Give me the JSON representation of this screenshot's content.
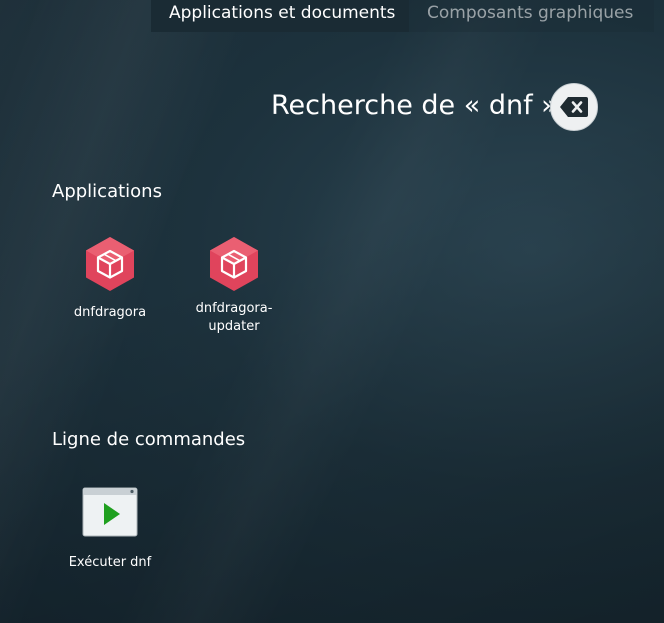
{
  "tabs": [
    {
      "label": "Applications et documents",
      "active": true
    },
    {
      "label": "Composants graphiques",
      "active": false
    }
  ],
  "search": {
    "title": "Recherche de « dnf »"
  },
  "sections": {
    "applications": {
      "title": "Applications",
      "items": [
        {
          "label": "dnfdragora",
          "icon": "package-icon"
        },
        {
          "label_line1": "dnfdragora-",
          "label_line2": "updater",
          "icon": "package-icon"
        }
      ]
    },
    "commands": {
      "title": "Ligne de commandes",
      "items": [
        {
          "label": "Exécuter dnf",
          "icon": "run-terminal-icon"
        }
      ]
    }
  },
  "colors": {
    "package_icon": "#e0445c",
    "run_icon": "#1fa01f",
    "tab_active_bg": "#1a2b34"
  }
}
